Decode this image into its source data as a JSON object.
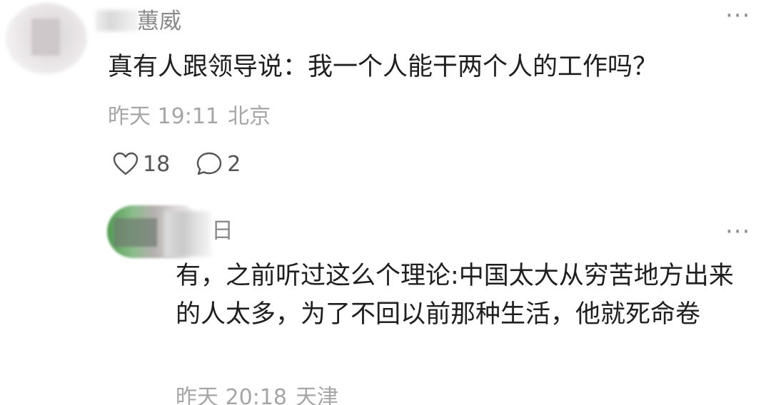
{
  "top_comment": {
    "author": "蕙威",
    "text": "真有人跟领导说：我一个人能干两个人的工作吗？",
    "time": "昨天 19:11",
    "location": "北京",
    "likes": "18",
    "replies": "2",
    "more_label": "···",
    "icons": {
      "like": "heart-icon",
      "reply": "comment-bubble-icon",
      "more": "more-dots-icon"
    }
  },
  "reply": {
    "author": "日",
    "text": "有，之前听过这么个理论:中国太大从穷苦地方出来的人太多，为了不回以前那种生活，他就死命卷",
    "time": "昨天 20:18",
    "location": "天津",
    "more_label": "···"
  }
}
